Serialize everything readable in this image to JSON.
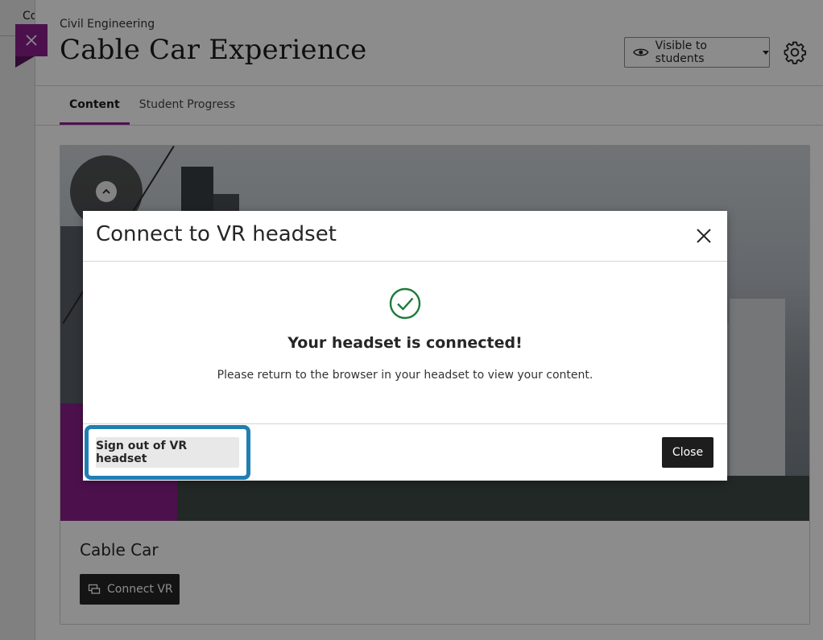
{
  "background_page": {
    "title_fragment": "Co"
  },
  "panel": {
    "breadcrumb": "Civil Engineering",
    "title": "Cable Car Experience",
    "visibility": {
      "label": "Visible to students",
      "icon": "eye-icon"
    },
    "settings_icon": "gear-icon",
    "close_icon": "close-icon",
    "tabs": [
      {
        "label": "Content",
        "active": true
      },
      {
        "label": "Student Progress",
        "active": false
      }
    ]
  },
  "card": {
    "title": "Cable Car",
    "connect_button": {
      "label": "Connect VR",
      "icon": "vr-connect-icon"
    },
    "orbit_control_icon": "chevron-up-icon"
  },
  "modal": {
    "title": "Connect to VR headset",
    "close_icon": "close-icon",
    "status_icon": "check-circle-icon",
    "heading": "Your headset is connected!",
    "message": "Please return to the browser in your headset to view your content.",
    "signout_label": "Sign out of VR headset",
    "close_label": "Close"
  },
  "colors": {
    "accent_purple": "#8a1f8c",
    "focus_ring": "#1f7fb4",
    "success_green": "#1e7b3c",
    "dark_button": "#1d1d1d"
  }
}
